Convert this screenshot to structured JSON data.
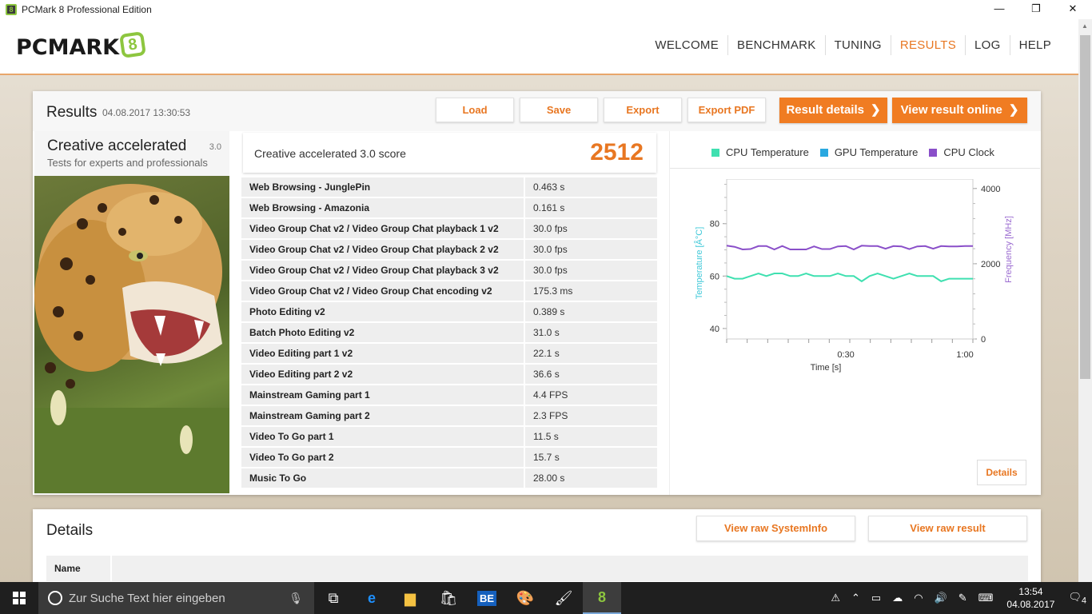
{
  "window": {
    "title": "PCMark 8 Professional Edition",
    "minimize": "—",
    "restore": "❐",
    "close": "✕"
  },
  "logo": {
    "text": "PCMARK",
    "version_mark": "8"
  },
  "nav": [
    {
      "label": "WELCOME",
      "active": false
    },
    {
      "label": "BENCHMARK",
      "active": false
    },
    {
      "label": "TUNING",
      "active": false
    },
    {
      "label": "RESULTS",
      "active": true
    },
    {
      "label": "LOG",
      "active": false
    },
    {
      "label": "HELP",
      "active": false
    }
  ],
  "results": {
    "title": "Results",
    "date": "04.08.2017 13:30:53",
    "buttons": {
      "load": "Load",
      "save": "Save",
      "export": "Export",
      "export_pdf": "Export PDF",
      "result_details": "Result details",
      "view_online": "View result online"
    },
    "benchmark": {
      "name": "Creative accelerated",
      "version": "3.0",
      "subtitle": "Tests for experts and professionals"
    },
    "score": {
      "label": "Creative accelerated 3.0 score",
      "value": "2512"
    },
    "rows": [
      {
        "name": "Web Browsing - JunglePin",
        "value": "0.463 s"
      },
      {
        "name": "Web Browsing - Amazonia",
        "value": "0.161 s"
      },
      {
        "name": "Video Group Chat v2 / Video Group Chat playback 1 v2",
        "value": "30.0 fps"
      },
      {
        "name": "Video Group Chat v2 / Video Group Chat playback 2 v2",
        "value": "30.0 fps"
      },
      {
        "name": "Video Group Chat v2 / Video Group Chat playback 3 v2",
        "value": "30.0 fps"
      },
      {
        "name": "Video Group Chat v2 / Video Group Chat encoding v2",
        "value": "175.3 ms"
      },
      {
        "name": "Photo Editing v2",
        "value": "0.389 s"
      },
      {
        "name": "Batch Photo Editing v2",
        "value": "31.0 s"
      },
      {
        "name": "Video Editing part 1 v2",
        "value": "22.1 s"
      },
      {
        "name": "Video Editing part 2 v2",
        "value": "36.6 s"
      },
      {
        "name": "Mainstream Gaming part 1",
        "value": "4.4 FPS"
      },
      {
        "name": "Mainstream Gaming part 2",
        "value": "2.3 FPS"
      },
      {
        "name": "Video To Go part 1",
        "value": "11.5 s"
      },
      {
        "name": "Video To Go part 2",
        "value": "15.7 s"
      },
      {
        "name": "Music To Go",
        "value": "28.00 s"
      }
    ],
    "details_button": "Details"
  },
  "chart_data": {
    "type": "line",
    "legend": [
      {
        "name": "CPU Temperature",
        "color": "#3fe0b0"
      },
      {
        "name": "GPU Temperature",
        "color": "#29a8e0"
      },
      {
        "name": "CPU Clock",
        "color": "#8a4fc9"
      }
    ],
    "xlabel": "Time [s]",
    "ylabel_left": "Temperature [Â°C]",
    "ylabel_right": "Frequency [MHz]",
    "x_ticks": [
      "0:30",
      "1:00"
    ],
    "yleft_ticks": [
      "40",
      "60",
      "80"
    ],
    "yright_ticks": [
      "0",
      "2000",
      "4000"
    ],
    "xlim": [
      0,
      62
    ],
    "ylim_left": [
      36,
      97
    ],
    "ylim_right": [
      0,
      4250
    ],
    "series": [
      {
        "name": "CPU Temperature",
        "axis": "left",
        "color": "#3fe0b0",
        "x": [
          0,
          2,
          4,
          6,
          8,
          10,
          12,
          14,
          16,
          18,
          20,
          22,
          24,
          26,
          28,
          30,
          32,
          34,
          36,
          38,
          40,
          42,
          44,
          46,
          48,
          50,
          52,
          54,
          56,
          58,
          60,
          62
        ],
        "y": [
          60,
          59,
          59,
          60,
          61,
          60,
          61,
          61,
          60,
          60,
          61,
          60,
          60,
          60,
          61,
          60,
          60,
          58,
          60,
          61,
          60,
          59,
          60,
          61,
          60,
          60,
          60,
          58,
          59,
          59,
          59,
          59
        ]
      },
      {
        "name": "CPU Clock",
        "axis": "right",
        "color": "#8a4fc9",
        "x": [
          0,
          2,
          4,
          6,
          8,
          10,
          12,
          14,
          16,
          18,
          20,
          22,
          24,
          26,
          28,
          30,
          32,
          34,
          36,
          38,
          40,
          42,
          44,
          46,
          48,
          50,
          52,
          54,
          56,
          58,
          60,
          62
        ],
        "y": [
          2480,
          2450,
          2380,
          2390,
          2470,
          2470,
          2380,
          2470,
          2380,
          2380,
          2380,
          2460,
          2390,
          2390,
          2460,
          2470,
          2380,
          2480,
          2470,
          2470,
          2400,
          2470,
          2460,
          2390,
          2460,
          2470,
          2400,
          2470,
          2460,
          2460,
          2470,
          2470
        ]
      }
    ]
  },
  "details": {
    "title": "Details",
    "view_sysinfo": "View raw SystemInfo",
    "view_result": "View raw result",
    "name_header": "Name"
  },
  "taskbar": {
    "search_placeholder": "Zur Suche Text hier eingeben",
    "time": "13:54",
    "date": "04.08.2017",
    "notifications": "4"
  }
}
